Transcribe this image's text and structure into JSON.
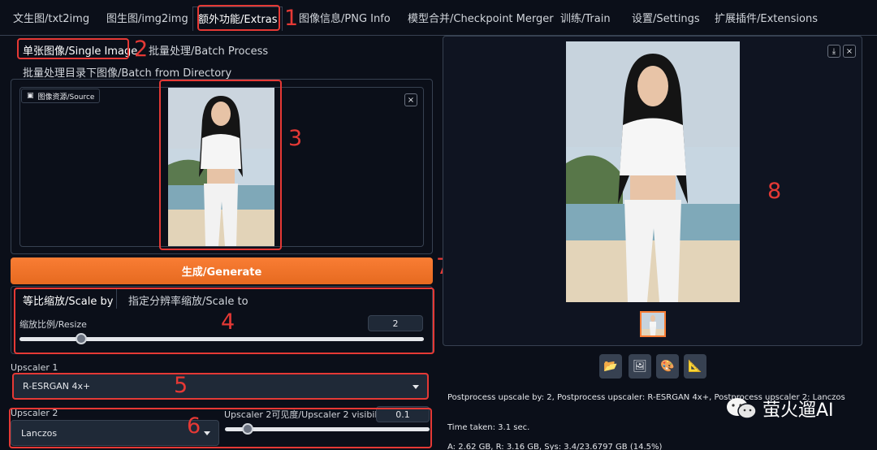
{
  "tabs": [
    {
      "label": "文生图/txt2img"
    },
    {
      "label": "图生图/img2img"
    },
    {
      "label": "额外功能/Extras"
    },
    {
      "label": "图像信息/PNG Info"
    },
    {
      "label": "模型合并/Checkpoint Merger"
    },
    {
      "label": "训练/Train"
    },
    {
      "label": "设置/Settings"
    },
    {
      "label": "扩展插件/Extensions"
    }
  ],
  "mode_tabs": {
    "single": "单张图像/Single Image",
    "batch": "批量处理/Batch Process",
    "batch_dir": "批量处理目录下图像/Batch from Directory"
  },
  "source": {
    "label": "图像资源/Source",
    "close": "×"
  },
  "generate_label": "生成/Generate",
  "scale_tabs": {
    "scale_by": "等比缩放/Scale by",
    "scale_to": "指定分辨率缩放/Scale to"
  },
  "resize": {
    "label": "缩放比例/Resize",
    "value": "2"
  },
  "upscaler1": {
    "label": "Upscaler 1",
    "value": "R-ESRGAN 4x+"
  },
  "upscaler2": {
    "label": "Upscaler 2",
    "value": "Lanczos",
    "visibility_label": "Upscaler 2可见度/Upscaler 2 visibility",
    "visibility_value": "0.1"
  },
  "annotations": [
    "1",
    "2",
    "3",
    "4",
    "5",
    "6",
    "7",
    "8"
  ],
  "output": {
    "download": "⤓",
    "close": "×",
    "info_line": "Postprocess upscale by: 2, Postprocess upscaler: R-ESRGAN 4x+, Postprocess upscaler 2: Lanczos",
    "time_taken": "Time taken: 3.1 sec.",
    "memory": "A: 2.62 GB, R: 3.16 GB, Sys: 3.4/23.6797 GB (14.5%)"
  },
  "action_icons": [
    "folder-icon",
    "image-icon",
    "palette-icon",
    "ruler-icon"
  ],
  "watermark": "萤火遛AI",
  "colors": {
    "accent": "#f97d34",
    "annotation": "#e53935",
    "background": "#0b0f19"
  }
}
